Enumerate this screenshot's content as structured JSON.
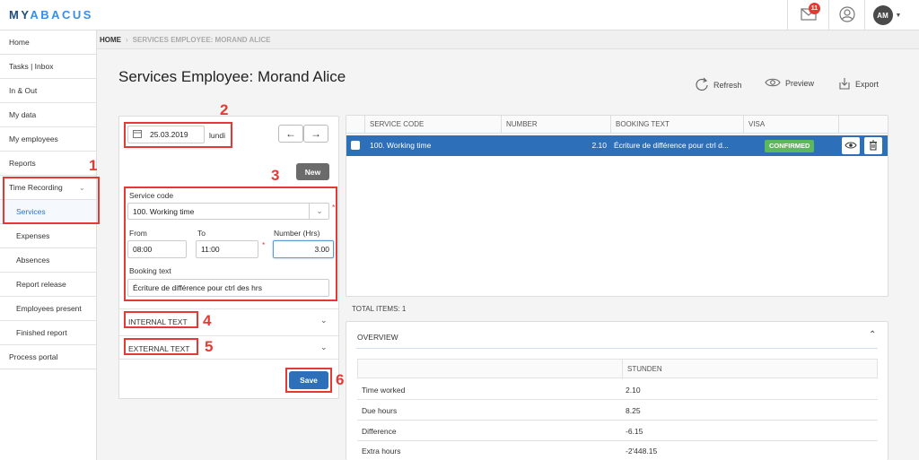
{
  "app": {
    "logo_main": "MYABACUS",
    "logo_prefix": "MY",
    "logo_suffix": "ABACUS",
    "mail_count": "11",
    "avatar_initials": "AM"
  },
  "sidebar": {
    "items": [
      {
        "label": "Home"
      },
      {
        "label": "Tasks | Inbox"
      },
      {
        "label": "In & Out"
      },
      {
        "label": "My data"
      },
      {
        "label": "My employees"
      },
      {
        "label": "Reports"
      },
      {
        "label": "Time Recording"
      },
      {
        "label": "Services"
      },
      {
        "label": "Expenses"
      },
      {
        "label": "Absences"
      },
      {
        "label": "Report release"
      },
      {
        "label": "Employees present"
      },
      {
        "label": "Finished report"
      },
      {
        "label": "Process portal"
      }
    ]
  },
  "breadcrumb": {
    "home": "HOME",
    "current": "SERVICES EMPLOYEE: MORAND ALICE"
  },
  "page": {
    "title": "Services Employee: Morand Alice"
  },
  "actions": {
    "refresh": "Refresh",
    "preview": "Preview",
    "export": "Export"
  },
  "form": {
    "date": "25.03.2019",
    "weekday": "lundi",
    "new_label": "New",
    "service_code_label": "Service code",
    "service_code_value": "100. Working time",
    "from_label": "From",
    "from_value": "08:00",
    "to_label": "To",
    "to_value": "11:00",
    "number_label": "Number (Hrs)",
    "number_value": "3.00",
    "booking_label": "Booking text",
    "booking_value": "Écriture de différence pour ctrl des hrs",
    "internal_text": "INTERNAL TEXT",
    "external_text": "EXTERNAL TEXT",
    "save_label": "Save",
    "required_mark": "*"
  },
  "annotations": {
    "n1": "1",
    "n2": "2",
    "n3": "3",
    "n4": "4",
    "n5": "5",
    "n6": "6"
  },
  "table": {
    "headers": [
      "SERVICE CODE",
      "NUMBER",
      "BOOKING TEXT",
      "VISA"
    ],
    "row": {
      "code": "100. Working time",
      "number": "2.10",
      "text": "Écriture de différence pour ctrl d...",
      "visa": "CONFIRMED"
    },
    "total": "TOTAL ITEMS: 1"
  },
  "overview": {
    "title": "OVERVIEW",
    "col": "STUNDEN",
    "rows": [
      {
        "label": "Time worked",
        "value": "2.10"
      },
      {
        "label": "Due hours",
        "value": "8.25"
      },
      {
        "label": "Difference",
        "value": "-6.15"
      },
      {
        "label": "Extra hours",
        "value": "-2'448.15"
      }
    ]
  },
  "colors": {
    "accent": "#2d6fb8",
    "annotation": "#e53935",
    "confirmed": "#5cb85c",
    "new_button": "#6b6b6b"
  }
}
